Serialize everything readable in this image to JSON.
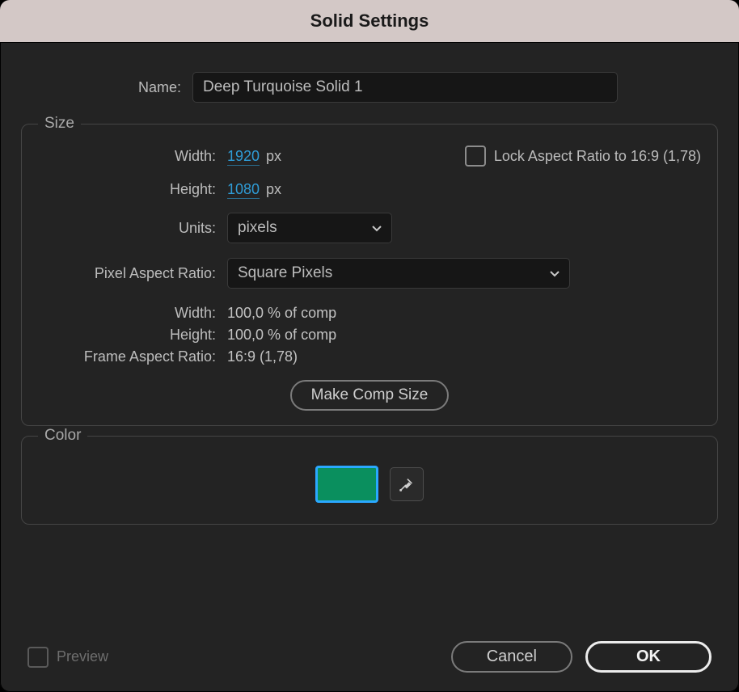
{
  "title": "Solid Settings",
  "name_label": "Name:",
  "name_value": "Deep Turquoise Solid 1",
  "size": {
    "legend": "Size",
    "width_label": "Width:",
    "width_value": "1920",
    "height_label": "Height:",
    "height_value": "1080",
    "px_unit": "px",
    "lock_label": "Lock Aspect Ratio to 16:9 (1,78)",
    "lock_checked": false,
    "units_label": "Units:",
    "units_value": "pixels",
    "par_label": "Pixel Aspect Ratio:",
    "par_value": "Square Pixels",
    "info_width_label": "Width:",
    "info_width_value": "100,0 % of comp",
    "info_height_label": "Height:",
    "info_height_value": "100,0 % of comp",
    "info_far_label": "Frame Aspect Ratio:",
    "info_far_value": "16:9 (1,78)",
    "make_comp_size": "Make Comp Size"
  },
  "color": {
    "legend": "Color",
    "swatch_hex": "#0a8f5e"
  },
  "footer": {
    "preview_label": "Preview",
    "preview_enabled": false,
    "cancel": "Cancel",
    "ok": "OK"
  }
}
